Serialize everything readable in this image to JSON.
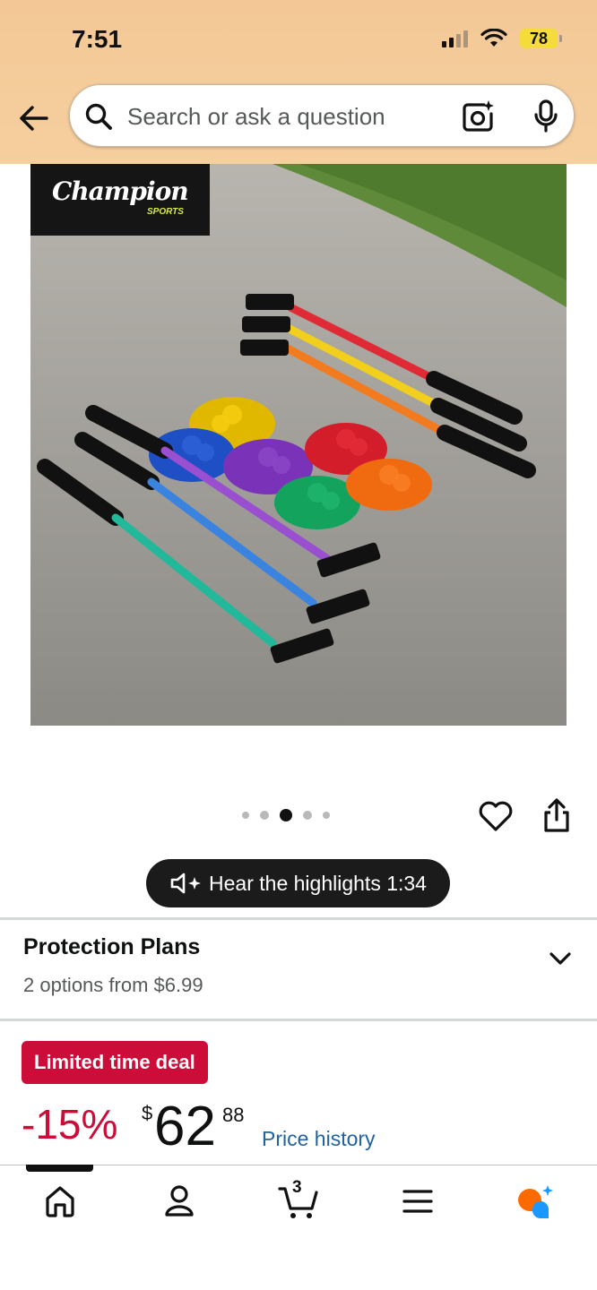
{
  "status_bar": {
    "time": "7:51",
    "battery": "78"
  },
  "search": {
    "placeholder": "Search or ask a question"
  },
  "product_image": {
    "brand_name": "Champion",
    "brand_sub": "SPORTS"
  },
  "carousel": {
    "count": 5,
    "active_index": 2
  },
  "audio_summary": {
    "label": "Hear the highlights 1:34"
  },
  "protection_plans": {
    "title": "Protection Plans",
    "subtitle": "2 options from $6.99"
  },
  "deal": {
    "badge": "Limited time deal",
    "discount": "-15%",
    "currency": "$",
    "price_whole": "62",
    "price_fraction": "88",
    "price_history_link": "Price history"
  },
  "tabbar": {
    "cart_count": "3"
  },
  "colors": {
    "header_bg": "#f3c896",
    "deal_red": "#cc0c39",
    "link_blue": "#2162a1",
    "dark_pill": "#1b1b1b"
  }
}
